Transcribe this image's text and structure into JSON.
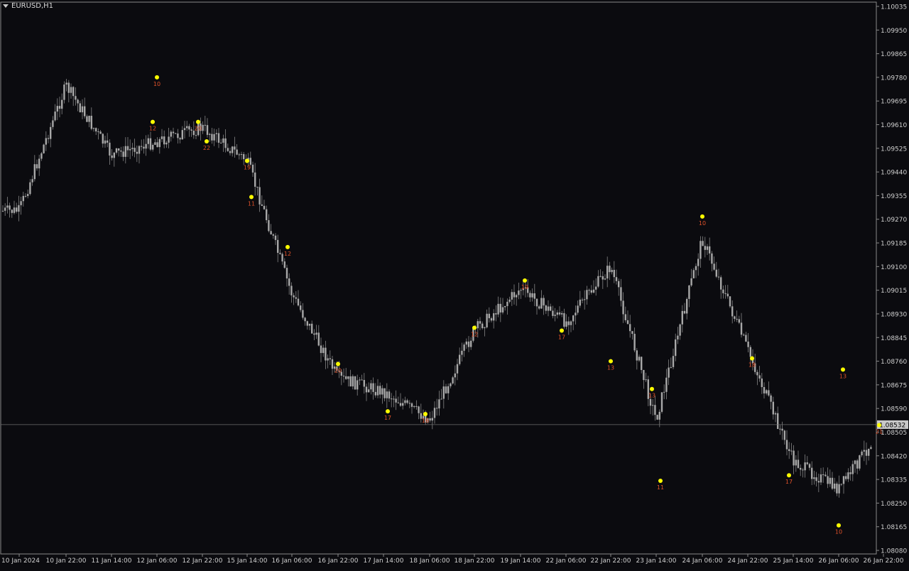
{
  "chart": {
    "symbol": "EURUSD,H1",
    "menu_icon": "dropdown-triangle-icon",
    "current_price": "1.08532",
    "background": "#0b0b0f",
    "candle_color": "#9a9a9a",
    "signal_color": "#ffff00",
    "signal_label_color": "#e0522a"
  },
  "y_axis": {
    "ticks": [
      "1.10035",
      "1.09950",
      "1.09865",
      "1.09780",
      "1.09695",
      "1.09610",
      "1.09525",
      "1.09440",
      "1.09355",
      "1.09270",
      "1.09185",
      "1.09100",
      "1.09015",
      "1.08930",
      "1.08845",
      "1.08760",
      "1.08675",
      "1.08590",
      "1.08505",
      "1.08420",
      "1.08335",
      "1.08250",
      "1.08165",
      "1.08080"
    ]
  },
  "x_axis": {
    "ticks": [
      "10 Jan 2024",
      "10 Jan 22:00",
      "11 Jan 14:00",
      "12 Jan 06:00",
      "12 Jan 22:00",
      "15 Jan 14:00",
      "16 Jan 06:00",
      "16 Jan 22:00",
      "17 Jan 14:00",
      "18 Jan 06:00",
      "18 Jan 22:00",
      "19 Jan 14:00",
      "22 Jan 06:00",
      "22 Jan 22:00",
      "23 Jan 14:00",
      "24 Jan 06:00",
      "24 Jan 22:00",
      "25 Jan 14:00",
      "26 Jan 06:00",
      "26 Jan 22:00"
    ]
  },
  "chart_data": {
    "type": "candlestick",
    "symbol": "EURUSD",
    "timeframe": "H1",
    "ylim": [
      1.0808,
      1.10035
    ],
    "x_range": [
      "10 Jan 2024",
      "26 Jan 22:00"
    ],
    "grid": false,
    "current_price": 1.08532,
    "price_path": [
      {
        "x": "10 Jan 2024",
        "y": 1.093
      },
      {
        "x": "10 Jan 22:00",
        "y": 1.0975
      },
      {
        "x": "11 Jan 14:00",
        "y": 1.095
      },
      {
        "x": "12 Jan 06:00",
        "y": 1.0955
      },
      {
        "x": "12 Jan 22:00",
        "y": 1.096
      },
      {
        "x": "15 Jan 14:00",
        "y": 1.0948
      },
      {
        "x": "16 Jan 06:00",
        "y": 1.09
      },
      {
        "x": "16 Jan 22:00",
        "y": 1.087
      },
      {
        "x": "17 Jan 14:00",
        "y": 1.0865
      },
      {
        "x": "18 Jan 06:00",
        "y": 1.0855
      },
      {
        "x": "18 Jan 22:00",
        "y": 1.0887
      },
      {
        "x": "19 Jan 14:00",
        "y": 1.0902
      },
      {
        "x": "22 Jan 06:00",
        "y": 1.089
      },
      {
        "x": "22 Jan 22:00",
        "y": 1.091
      },
      {
        "x": "23 Jan 14:00",
        "y": 1.0855
      },
      {
        "x": "24 Jan 06:00",
        "y": 1.092
      },
      {
        "x": "24 Jan 22:00",
        "y": 1.088
      },
      {
        "x": "25 Jan 14:00",
        "y": 1.084
      },
      {
        "x": "26 Jan 06:00",
        "y": 1.083
      },
      {
        "x": "26 Jan 22:00",
        "y": 1.0853
      }
    ],
    "signals": [
      {
        "x": "12 Jan 06:00",
        "y": 1.0962,
        "label": "12"
      },
      {
        "x": "12 Jan 06:00",
        "y": 1.0978,
        "label": "10"
      },
      {
        "x": "12 Jan 22:00",
        "y": 1.0955,
        "label": "22"
      },
      {
        "x": "12 Jan 22:00",
        "y": 1.0962,
        "label": "20"
      },
      {
        "x": "15 Jan 14:00",
        "y": 1.0948,
        "label": "19"
      },
      {
        "x": "15 Jan 14:00",
        "y": 1.0935,
        "label": "11"
      },
      {
        "x": "16 Jan 06:00",
        "y": 1.0917,
        "label": "12"
      },
      {
        "x": "16 Jan 22:00",
        "y": 1.0875,
        "label": "20"
      },
      {
        "x": "17 Jan 14:00",
        "y": 1.0858,
        "label": "17"
      },
      {
        "x": "18 Jan 06:00",
        "y": 1.0857,
        "label": "16"
      },
      {
        "x": "18 Jan 22:00",
        "y": 1.0888,
        "label": "12"
      },
      {
        "x": "19 Jan 14:00",
        "y": 1.0905,
        "label": "19"
      },
      {
        "x": "22 Jan 06:00",
        "y": 1.0887,
        "label": "17"
      },
      {
        "x": "22 Jan 22:00",
        "y": 1.0876,
        "label": "13"
      },
      {
        "x": "23 Jan 14:00",
        "y": 1.0833,
        "label": "11"
      },
      {
        "x": "23 Jan 14:00",
        "y": 1.0866,
        "label": "13"
      },
      {
        "x": "24 Jan 06:00",
        "y": 1.0928,
        "label": "10"
      },
      {
        "x": "24 Jan 22:00",
        "y": 1.0877,
        "label": "18"
      },
      {
        "x": "25 Jan 14:00",
        "y": 1.0835,
        "label": "17"
      },
      {
        "x": "26 Jan 06:00",
        "y": 1.0817,
        "label": "10"
      },
      {
        "x": "26 Jan 06:00",
        "y": 1.0873,
        "label": "13"
      },
      {
        "x": "26 Jan 22:00",
        "y": 1.0853,
        "label": "21"
      }
    ]
  }
}
